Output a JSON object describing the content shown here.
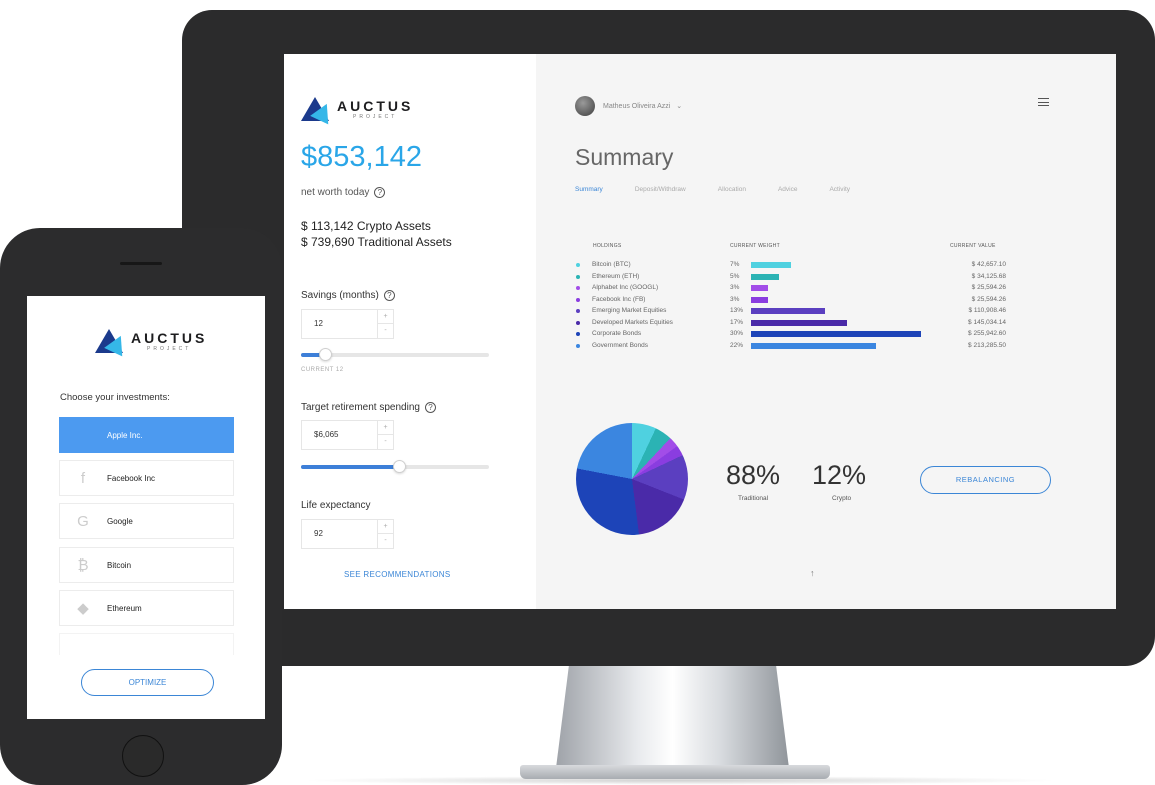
{
  "desktop": {
    "logo": {
      "word": "AUCTUS",
      "sub": "PROJECT"
    },
    "net_worth": "$853,142",
    "net_worth_label": "net worth today",
    "crypto_assets": "$ 113,142 Crypto Assets",
    "traditional_assets": "$ 739,690 Traditional Assets",
    "savings": {
      "label": "Savings (months)",
      "value": "12",
      "current": "CURRENT 12",
      "slider_fraction": 0.13
    },
    "retirement": {
      "label": "Target retirement spending",
      "value": "$6,065",
      "slider_fraction": 0.52
    },
    "life": {
      "label": "Life expectancy",
      "value": "92"
    },
    "see_recommendations": "SEE RECOMMENDATIONS",
    "user_name": "Matheus Oliveira Azzi",
    "summary_title": "Summary",
    "tabs": [
      "Summary",
      "Deposit/Withdraw",
      "Allocation",
      "Advice",
      "Activity"
    ],
    "table_headers": {
      "holdings": "HOLDINGS",
      "weight": "CURRENT WEIGHT",
      "value": "CURRENT VALUE"
    },
    "holdings": [
      {
        "name": "Bitcoin (BTC)",
        "pct": "7%",
        "value": "$ 42,657.10",
        "color": "#4fd1e0",
        "weight": 7
      },
      {
        "name": "Ethereum (ETH)",
        "pct": "5%",
        "value": "$ 34,125.68",
        "color": "#2bb3b4",
        "weight": 5
      },
      {
        "name": "Alphabet Inc (GOOGL)",
        "pct": "3%",
        "value": "$ 25,594.26",
        "color": "#a24de8",
        "weight": 3
      },
      {
        "name": "Facebook Inc (FB)",
        "pct": "3%",
        "value": "$ 25,594.26",
        "color": "#8a3de0",
        "weight": 3
      },
      {
        "name": "Emerging Market Equities",
        "pct": "13%",
        "value": "$ 110,908.46",
        "color": "#5b3fc0",
        "weight": 13
      },
      {
        "name": "Developed Markets Equities",
        "pct": "17%",
        "value": "$ 145,034.14",
        "color": "#4a2aa8",
        "weight": 17
      },
      {
        "name": "Corporate Bonds",
        "pct": "30%",
        "value": "$ 255,942.60",
        "color": "#1d44b8",
        "weight": 30
      },
      {
        "name": "Government Bonds",
        "pct": "22%",
        "value": "$ 213,285.50",
        "color": "#3b86e0",
        "weight": 22
      }
    ],
    "traditional_pct": "88%",
    "traditional_label": "Traditional",
    "crypto_pct": "12%",
    "crypto_label": "Crypto",
    "rebalancing": "REBALANCING",
    "scroll_top_glyph": "↑"
  },
  "phone": {
    "logo": {
      "word": "AUCTUS",
      "sub": "PROJECT"
    },
    "choose_label": "Choose your investments:",
    "investments": [
      {
        "label": "Apple Inc.",
        "icon": "apple-icon",
        "glyph": "",
        "selected": true
      },
      {
        "label": "Facebook Inc",
        "icon": "facebook-icon",
        "glyph": "f",
        "selected": false
      },
      {
        "label": "Google",
        "icon": "google-icon",
        "glyph": "G",
        "selected": false
      },
      {
        "label": "Bitcoin",
        "icon": "bitcoin-icon",
        "glyph": "₿",
        "selected": false
      },
      {
        "label": "Ethereum",
        "icon": "ethereum-icon",
        "glyph": "◆",
        "selected": false
      }
    ],
    "optimize": "OPTIMIZE"
  }
}
